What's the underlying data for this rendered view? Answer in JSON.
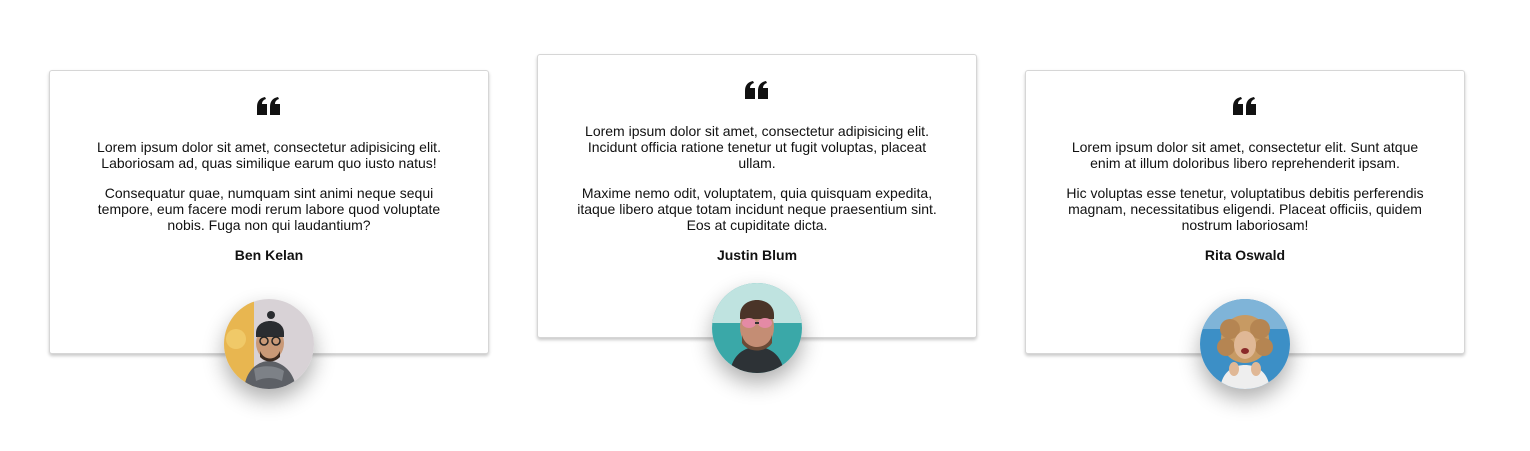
{
  "testimonials": [
    {
      "quote_icon": "quote-icon",
      "paragraph1": "Lorem ipsum dolor sit amet, consectetur adipisicing elit. Laboriosam ad, quas similique earum quo iusto natus!",
      "paragraph2": "Consequatur quae, numquam sint animi neque sequi tempore, eum facere modi rerum labore quod voluptate nobis. Fuga non qui laudantium?",
      "name": "Ben Kelan",
      "avatar": "photo of man with beanie, glasses and scarf"
    },
    {
      "quote_icon": "quote-icon",
      "paragraph1": "Lorem ipsum dolor sit amet, consectetur adipisicing elit. Incidunt officia ratione tenetur ut fugit voluptas, placeat ullam.",
      "paragraph2": "Maxime nemo odit, voluptatem, quia quisquam expedita, itaque libero atque totam incidunt neque praesentium sint. Eos at cupiditate dicta.",
      "name": "Justin Blum",
      "avatar": "photo of man with pink sunglasses"
    },
    {
      "quote_icon": "quote-icon",
      "paragraph1": "Lorem ipsum dolor sit amet, consectetur elit. Sunt atque enim at illum doloribus libero reprehenderit ipsam.",
      "paragraph2": "Hic voluptas esse tenetur, voluptatibus debitis perferendis magnam, necessitatibus eligendi. Placeat officiis, quidem nostrum laboriosam!",
      "name": "Rita Oswald",
      "avatar": "photo of laughing woman with curly hair"
    }
  ]
}
